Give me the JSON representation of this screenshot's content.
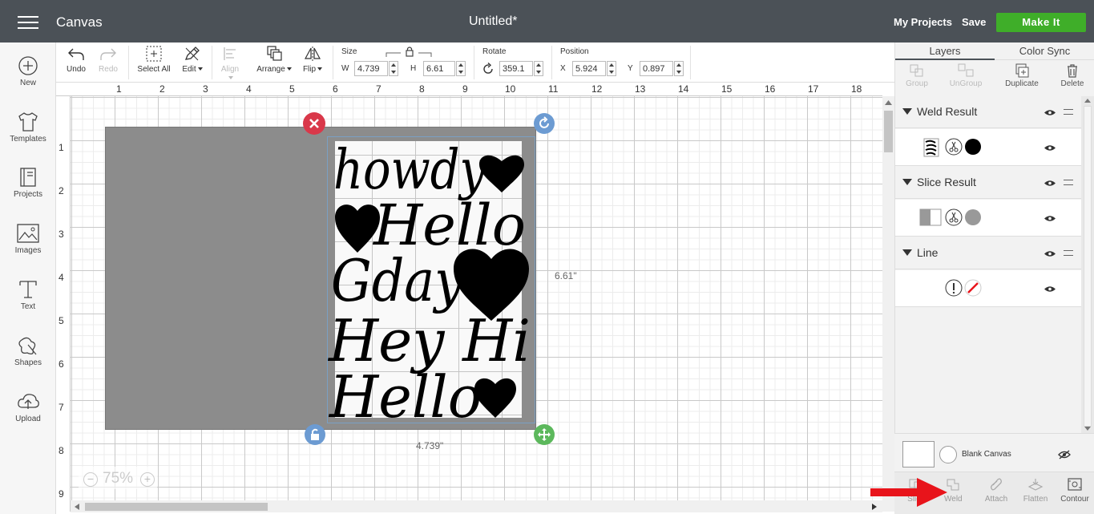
{
  "header": {
    "app_title": "Canvas",
    "doc_title": "Untitled*",
    "my_projects": "My Projects",
    "save": "Save",
    "make_it": "Make It"
  },
  "left_nav": {
    "new": "New",
    "templates": "Templates",
    "projects": "Projects",
    "images": "Images",
    "text": "Text",
    "shapes": "Shapes",
    "upload": "Upload"
  },
  "toolbar": {
    "undo": "Undo",
    "redo": "Redo",
    "select_all": "Select All",
    "edit": "Edit",
    "align": "Align",
    "arrange": "Arrange",
    "flip": "Flip",
    "size_label": "Size",
    "w_label": "W",
    "w_value": "4.739",
    "h_label": "H",
    "h_value": "6.61",
    "rotate_label": "Rotate",
    "rotate_value": "359.1",
    "position_label": "Position",
    "x_label": "X",
    "x_value": "5.924",
    "y_label": "Y",
    "y_value": "0.897"
  },
  "rulers": {
    "top": [
      "1",
      "2",
      "3",
      "4",
      "5",
      "6",
      "7",
      "8",
      "9",
      "10",
      "11",
      "12",
      "13",
      "14",
      "15",
      "16",
      "17",
      "18"
    ],
    "left": [
      "1",
      "2",
      "3",
      "4",
      "5",
      "6",
      "7",
      "8",
      "9"
    ]
  },
  "canvas": {
    "height_label": "6.61\"",
    "width_label": "4.739\"",
    "zoom": "75%",
    "zoom_minus": "−",
    "zoom_plus": "+",
    "script_lines": [
      "howdy",
      "Hello",
      "Gday",
      "Hey Hi",
      "Hello"
    ]
  },
  "right_panel": {
    "tabs": [
      "Layers",
      "Color Sync"
    ],
    "actions": {
      "group": "Group",
      "ungroup": "UnGroup",
      "duplicate": "Duplicate",
      "delete": "Delete"
    },
    "layers": [
      {
        "name": "Weld Result"
      },
      {
        "name": "Slice Result"
      },
      {
        "name": "Line"
      }
    ],
    "blank_canvas": "Blank Canvas",
    "bottom_actions": {
      "slice": "Slice",
      "weld": "Weld",
      "attach": "Attach",
      "flatten": "Flatten",
      "contour": "Contour"
    }
  },
  "colors": {
    "header_bg": "#4b5157",
    "make_it": "#3fae29",
    "delete_handle": "#d9384a",
    "rotate_handle": "#6c9bd2",
    "scale_handle": "#5cb85c",
    "arrow_annotation": "#e8141b"
  }
}
